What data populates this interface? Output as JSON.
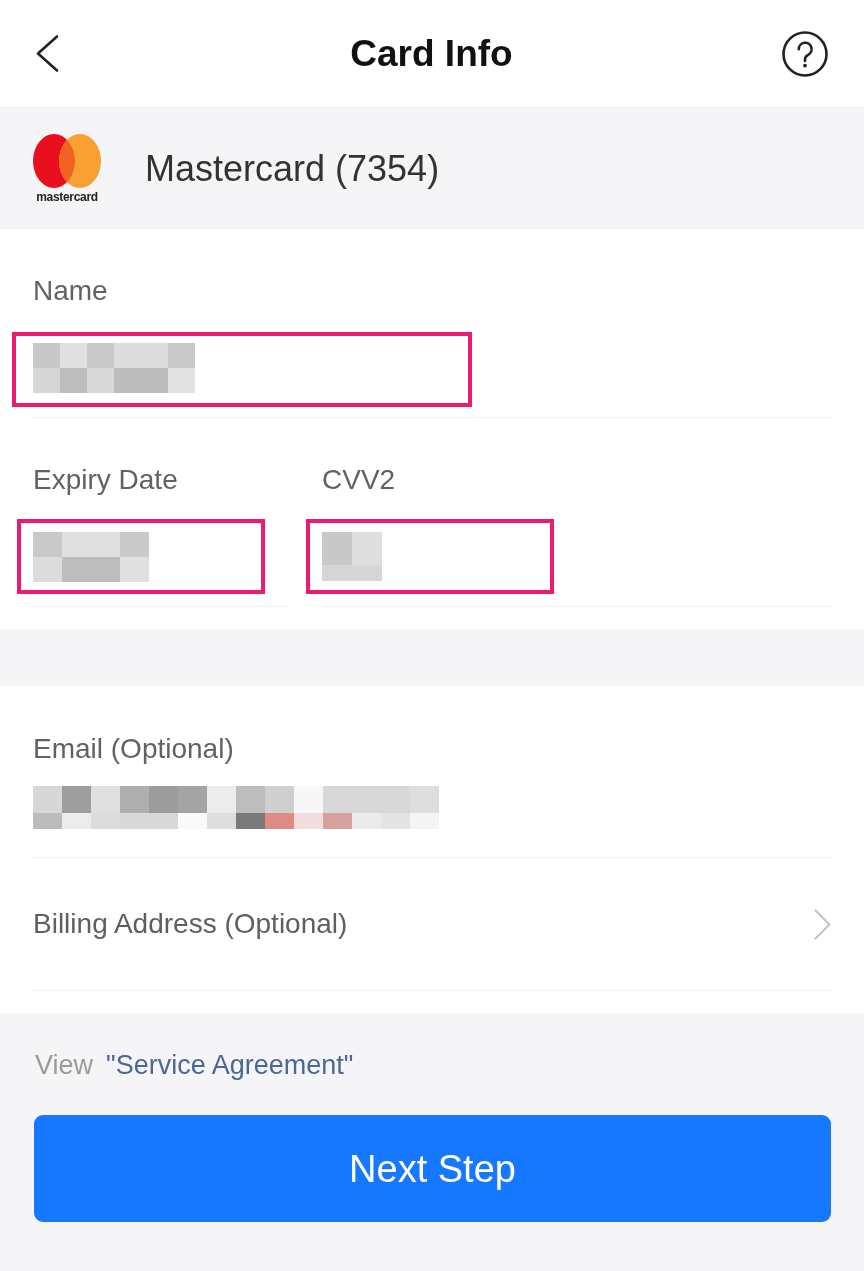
{
  "header": {
    "title": "Card Info"
  },
  "card": {
    "logo_text": "mastercard",
    "label": "Mastercard (7354)"
  },
  "card_details": {
    "rows": [
      {
        "fields": [
          {
            "label": "Name",
            "redacted": true,
            "highlighted": true
          }
        ]
      },
      {
        "fields": [
          {
            "label": "Expiry Date",
            "redacted": true,
            "highlighted": true
          },
          {
            "label": "CVV2",
            "redacted": true,
            "highlighted": true
          }
        ]
      }
    ]
  },
  "contact": {
    "items": [
      {
        "kind": "input",
        "label": "Email (Optional)",
        "redacted": true,
        "highlighted": false
      },
      {
        "kind": "link",
        "label": "Billing Address (Optional)"
      }
    ]
  },
  "agreement": {
    "prefix": "View",
    "link": "\"Service Agreement\""
  },
  "next_button": {
    "label": "Next Step"
  }
}
